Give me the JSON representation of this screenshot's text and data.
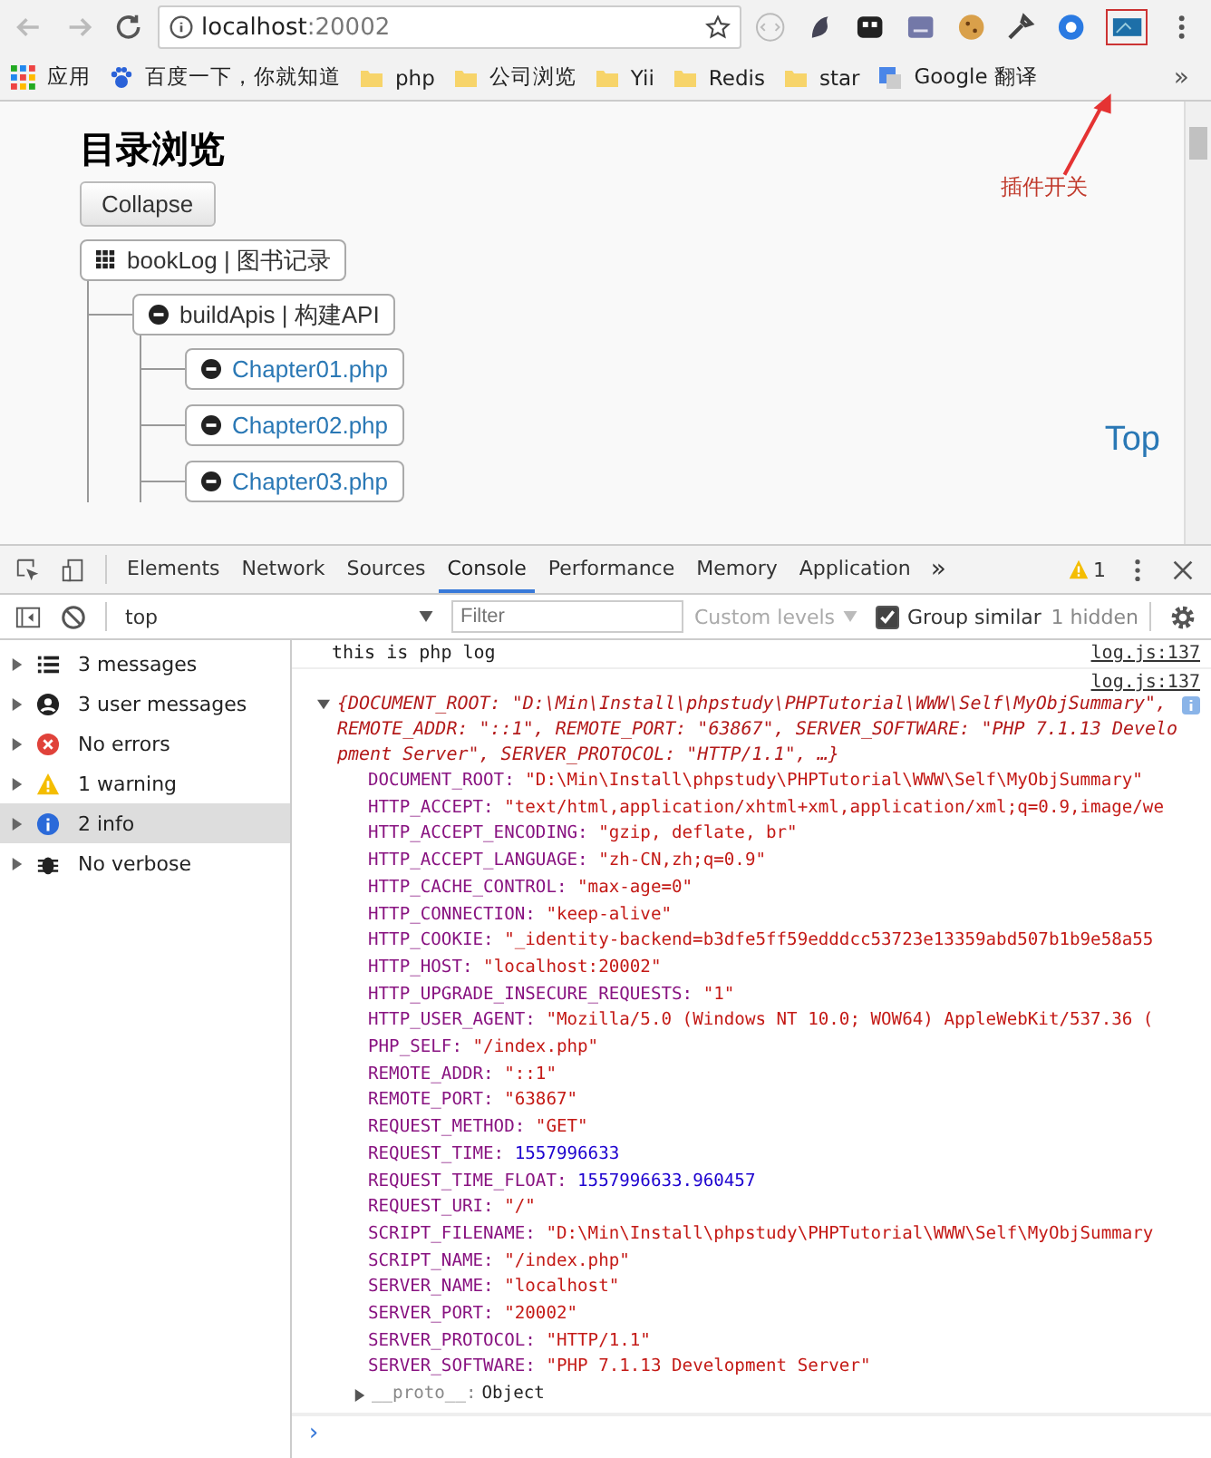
{
  "browser": {
    "address": {
      "host": "localhost",
      "port": ":20002"
    },
    "bookmarks": [
      {
        "kind": "apps",
        "label": "应用"
      },
      {
        "kind": "paw",
        "label": "百度一下，你就知道"
      },
      {
        "kind": "folder",
        "label": "php"
      },
      {
        "kind": "folder",
        "label": "公司浏览"
      },
      {
        "kind": "folder",
        "label": "Yii"
      },
      {
        "kind": "folder",
        "label": "Redis"
      },
      {
        "kind": "folder",
        "label": "star"
      },
      {
        "kind": "translate",
        "label": "Google 翻译"
      }
    ],
    "bookmarks_more": "»"
  },
  "annotation": {
    "label": "插件开关"
  },
  "page": {
    "heading": "目录浏览",
    "collapse_button": "Collapse",
    "top_link": "Top",
    "tree": [
      {
        "kind": "root",
        "label": "bookLog | 图书记录",
        "children": [
          {
            "kind": "folder",
            "label": "buildApis | 构建API",
            "children": [
              {
                "kind": "file",
                "label": "Chapter01.php"
              },
              {
                "kind": "file",
                "label": "Chapter02.php"
              },
              {
                "kind": "file",
                "label": "Chapter03.php"
              }
            ]
          }
        ]
      }
    ]
  },
  "devtools": {
    "tabs": [
      {
        "label": "Elements",
        "selected": false
      },
      {
        "label": "Network",
        "selected": false
      },
      {
        "label": "Sources",
        "selected": false
      },
      {
        "label": "Console",
        "selected": true
      },
      {
        "label": "Performance",
        "selected": false
      },
      {
        "label": "Memory",
        "selected": false
      },
      {
        "label": "Application",
        "selected": false
      }
    ],
    "more_tabs": "»",
    "warning_count": "1",
    "console_toolbar": {
      "context": "top",
      "filter_placeholder": "Filter",
      "levels": "Custom levels",
      "group_similar": {
        "label": "Group similar",
        "checked": true
      },
      "hidden": "1 hidden"
    },
    "sidebar": [
      {
        "kind": "list",
        "label": "3 messages",
        "selected": false
      },
      {
        "kind": "user",
        "label": "3 user messages",
        "selected": false
      },
      {
        "kind": "error",
        "label": "No errors",
        "selected": false
      },
      {
        "kind": "warning",
        "label": "1 warning",
        "selected": false
      },
      {
        "kind": "info",
        "label": "2 info",
        "selected": true
      },
      {
        "kind": "verbose",
        "label": "No verbose",
        "selected": false
      }
    ],
    "log": [
      {
        "kind": "text",
        "text": "this is php log",
        "source": "log.js:137"
      },
      {
        "kind": "object",
        "source": "log.js:137",
        "expanded": true,
        "summary": "{DOCUMENT_ROOT: \"D:\\Min\\Install\\phpstudy\\PHPTutorial\\WWW\\Self\\MyObjSummary\", REMOTE_ADDR: \"::1\", REMOTE_PORT: \"63867\", SERVER_SOFTWARE: \"PHP 7.1.13 Development Server\", SERVER_PROTOCOL: \"HTTP/1.1\", …}",
        "properties": [
          {
            "key": "DOCUMENT_ROOT:",
            "kind": "string",
            "value": "\"D:\\Min\\Install\\phpstudy\\PHPTutorial\\WWW\\Self\\MyObjSummary\""
          },
          {
            "key": "HTTP_ACCEPT:",
            "kind": "string",
            "value": "\"text/html,application/xhtml+xml,application/xml;q=0.9,image/we"
          },
          {
            "key": "HTTP_ACCEPT_ENCODING:",
            "kind": "string",
            "value": "\"gzip, deflate, br\""
          },
          {
            "key": "HTTP_ACCEPT_LANGUAGE:",
            "kind": "string",
            "value": "\"zh-CN,zh;q=0.9\""
          },
          {
            "key": "HTTP_CACHE_CONTROL:",
            "kind": "string",
            "value": "\"max-age=0\""
          },
          {
            "key": "HTTP_CONNECTION:",
            "kind": "string",
            "value": "\"keep-alive\""
          },
          {
            "key": "HTTP_COOKIE:",
            "kind": "string",
            "value": "\"_identity-backend=b3dfe5ff59edddcc53723e13359abd507b1b9e58a55"
          },
          {
            "key": "HTTP_HOST:",
            "kind": "string",
            "value": "\"localhost:20002\""
          },
          {
            "key": "HTTP_UPGRADE_INSECURE_REQUESTS:",
            "kind": "string",
            "value": "\"1\""
          },
          {
            "key": "HTTP_USER_AGENT:",
            "kind": "string",
            "value": "\"Mozilla/5.0 (Windows NT 10.0; WOW64) AppleWebKit/537.36 ("
          },
          {
            "key": "PHP_SELF:",
            "kind": "string",
            "value": "\"/index.php\""
          },
          {
            "key": "REMOTE_ADDR:",
            "kind": "string",
            "value": "\"::1\""
          },
          {
            "key": "REMOTE_PORT:",
            "kind": "string",
            "value": "\"63867\""
          },
          {
            "key": "REQUEST_METHOD:",
            "kind": "string",
            "value": "\"GET\""
          },
          {
            "key": "REQUEST_TIME:",
            "kind": "number",
            "value": "1557996633"
          },
          {
            "key": "REQUEST_TIME_FLOAT:",
            "kind": "number",
            "value": "1557996633.960457"
          },
          {
            "key": "REQUEST_URI:",
            "kind": "string",
            "value": "\"/\""
          },
          {
            "key": "SCRIPT_FILENAME:",
            "kind": "string",
            "value": "\"D:\\Min\\Install\\phpstudy\\PHPTutorial\\WWW\\Self\\MyObjSummary"
          },
          {
            "key": "SCRIPT_NAME:",
            "kind": "string",
            "value": "\"/index.php\""
          },
          {
            "key": "SERVER_NAME:",
            "kind": "string",
            "value": "\"localhost\""
          },
          {
            "key": "SERVER_PORT:",
            "kind": "string",
            "value": "\"20002\""
          },
          {
            "key": "SERVER_PROTOCOL:",
            "kind": "string",
            "value": "\"HTTP/1.1\""
          },
          {
            "key": "SERVER_SOFTWARE:",
            "kind": "string",
            "value": "\"PHP 7.1.13 Development Server\""
          }
        ],
        "proto": {
          "key": "__proto__:",
          "value": "Object"
        }
      }
    ],
    "prompt": "›"
  }
}
